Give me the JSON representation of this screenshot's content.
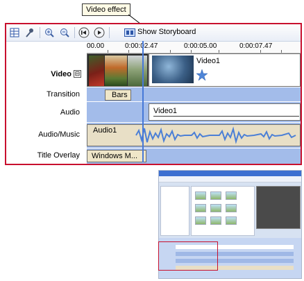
{
  "callout": {
    "text": "Video effect"
  },
  "toolbar": {
    "buttons": [
      {
        "name": "timeline-view-icon"
      },
      {
        "name": "microphone-icon"
      },
      {
        "name": "zoom-in-icon"
      },
      {
        "name": "zoom-out-icon"
      },
      {
        "name": "rewind-icon"
      },
      {
        "name": "play-icon"
      },
      {
        "name": "storyboard-icon"
      }
    ],
    "show_storyboard": "Show Storyboard"
  },
  "ruler": {
    "ticks": [
      "00.00",
      "0:00:02.47",
      "0:00:05.00",
      "0:00:07.47"
    ]
  },
  "tracks": {
    "video": "Video",
    "collapse": "⊟",
    "transition": "Transition",
    "audio": "Audio",
    "audio_music": "Audio/Music",
    "title_overlay": "Title Overlay"
  },
  "clips": {
    "video_clip": "Video1",
    "transition_clip": "Bars",
    "audio_clip": "Video1",
    "music_clip": "Audio1",
    "title_clip": "Windows M..."
  },
  "colors": {
    "frame_border": "#c8102e",
    "track_fill": "#a3bcea",
    "playhead": "#4678d8"
  }
}
